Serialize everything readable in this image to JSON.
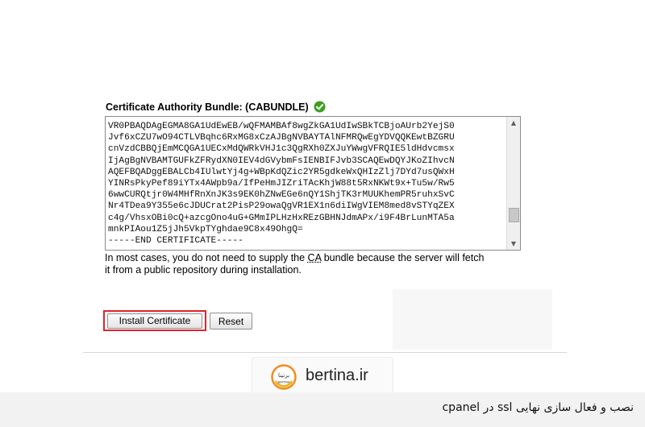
{
  "field": {
    "label": "Certificate Authority Bundle: (CABUNDLE)",
    "status_color": "#3aa020",
    "certificate_text": "VR0PBAQDAgEGMA8GA1UdEwEB/wQFMAMBAf8wgZkGA1UdIwSBkTCBjoAUrb2YejS0\nJvf6xCZU7wO94CTLVBqhc6RxMG8xCzAJBgNVBAYTAlNFMRQwEgYDVQQKEwtBZGRU\ncnVzdCBBQjEmMCQGA1UECxMdQWRkVHJ1c3QgRXh0ZXJuYWwgVFRQIE5ldHdvcmsx\nIjAgBgNVBAMTGUFkZFRydXN0IEV4dGVybmFsIENBIFJvb3SCAQEwDQYJKoZIhvcN\nAQEFBQADggEBALCb4IUlwtYj4g+WBpKdQZic2YR5gdkeWxQHIzZlj7DYd7usQWxH\nYINRsPkyPef89iYTx4AWpb9a/IfPeHmJIZriTAcKhjW88t5RxNKWt9x+Tu5w/Rw5\n6wwCURQtjr0W4MHfRnXnJK3s9EK0hZNwEGe6nQY1ShjTK3rMUUKhemPR5ruhxSvC\nNr4TDea9Y355e6cJDUCrat2PisP29owaQgVR1EX1n6diIWgVIEM8med8vSTYqZEX\nc4g/VhsxOBi0cQ+azcgOno4uG+GMmIPLHzHxREzGBHNJdmAPx/i9F4BrLunMTA5a\nmnkPIAou1Z5jJh5VkpTYghdae9C8x49OhgQ=\n-----END CERTIFICATE-----",
    "help_line1_before": "In most cases, you do not need to supply the ",
    "help_line1_abbr": "CA",
    "help_line1_after": " bundle because the server will fetch",
    "help_line2": "it from a public repository during installation."
  },
  "actions": {
    "install_label": "Install Certificate",
    "reset_label": "Reset",
    "highlight_color": "#e0222d"
  },
  "branding": {
    "logo_text": "bertina.ir",
    "logo_mark_text": "برتینا",
    "logo_mark_sub": "BERTINA",
    "accent_color": "#f28c1e"
  },
  "caption": {
    "text": "نصب و فعال سازی نهایی ssl در cpanel"
  }
}
